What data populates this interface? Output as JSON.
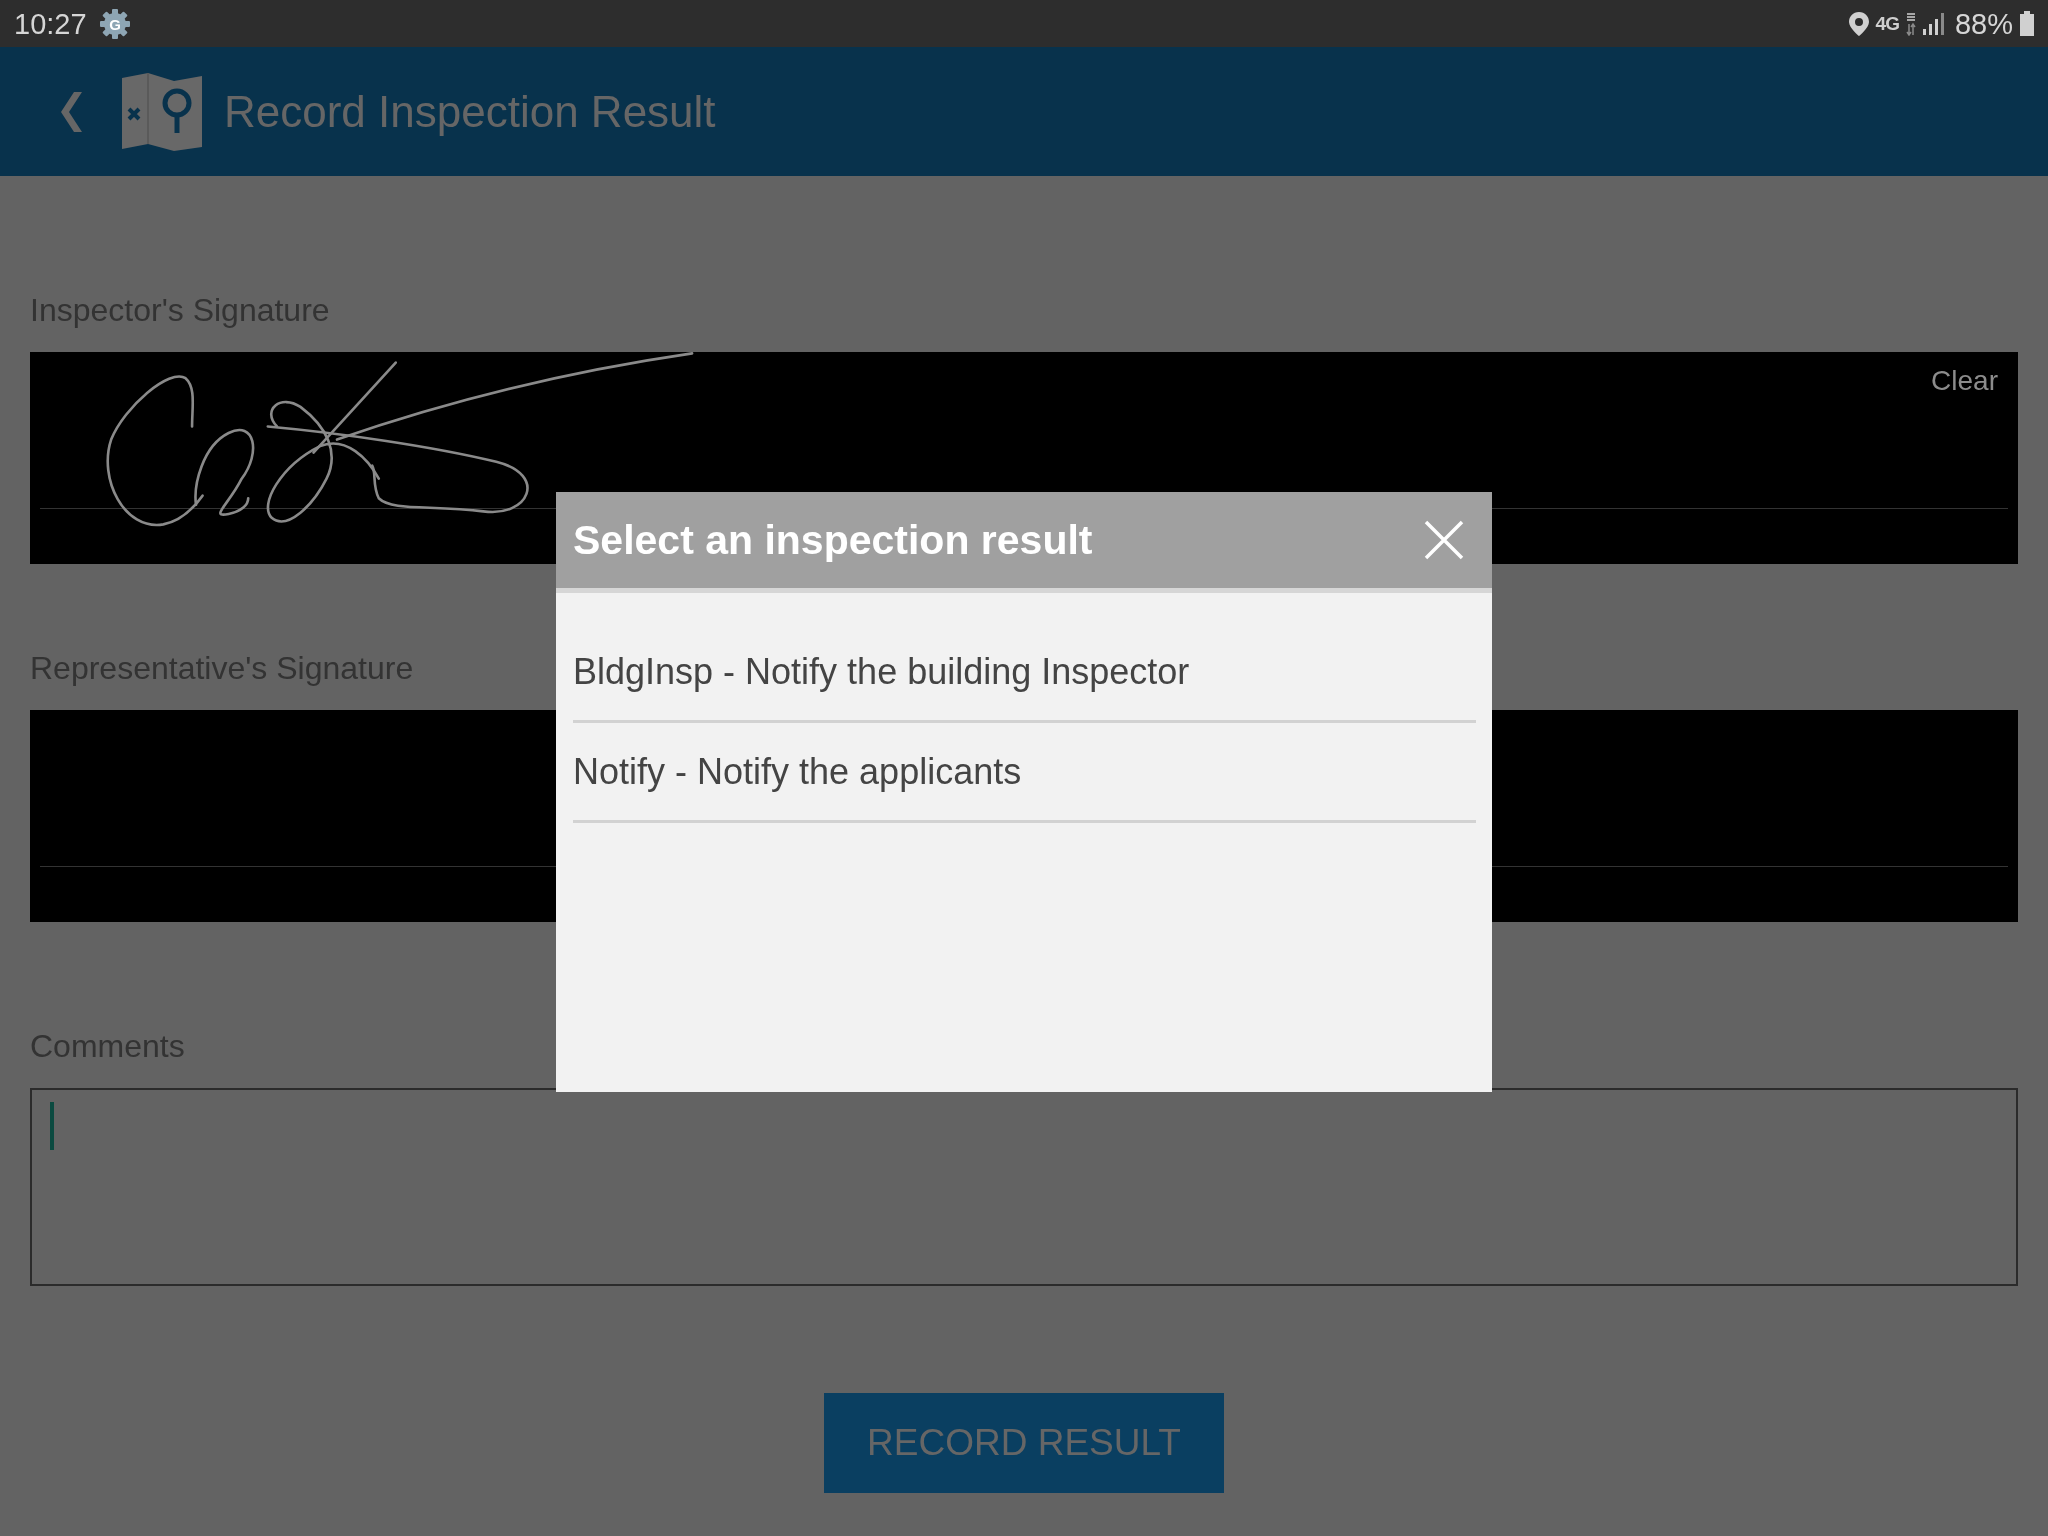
{
  "status_bar": {
    "time": "10:27",
    "notification_letter": "G",
    "network": "4G",
    "battery": "88%"
  },
  "header": {
    "title": "Record Inspection Result"
  },
  "form": {
    "signatures": [
      {
        "label": "Inspector's Signature",
        "signed": true,
        "clear_label": "Clear"
      },
      {
        "label": "Representative's Signature",
        "signed": false
      }
    ],
    "comments": {
      "label": "Comments",
      "focused": true
    },
    "submit": {
      "label": "RECORD RESULT"
    }
  },
  "dialog": {
    "title": "Select an inspection result",
    "options": [
      {
        "label": "BldgInsp - Notify the building Inspector",
        "selected": false
      },
      {
        "label": "Notify - Notify the applicants",
        "selected": false
      }
    ]
  }
}
